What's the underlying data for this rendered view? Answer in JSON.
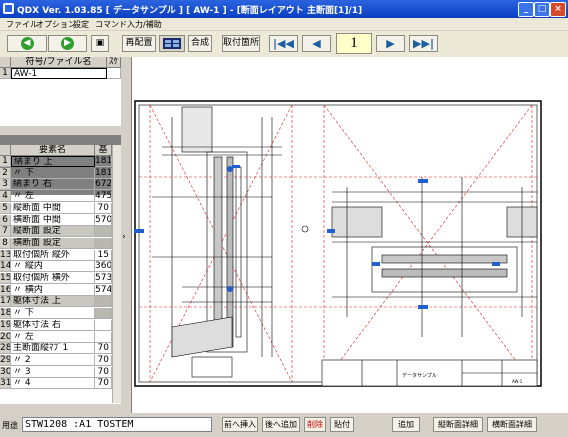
{
  "window": {
    "title": "QDX Ver. 1.03.85 [ データサンプル ] [ AW-1 ] - [断面レイアウト 主断面[1]/1]",
    "buttons": {
      "minimize": "_",
      "maximize": "□",
      "close": "×"
    }
  },
  "menu": [
    "ファイル",
    "オプション",
    "設定",
    "コマンド",
    "入力/補助"
  ],
  "toolbar": {
    "back_icon": "◀",
    "forward_icon": "▶",
    "save_icon": "▣",
    "rearrange": "再配置",
    "compose": "合成",
    "mount_point": "取付箇所",
    "first": "|◀◀",
    "prev": "◀",
    "page": "1",
    "next": "▶",
    "last": "▶▶|"
  },
  "file_grid": {
    "headers": [
      "符号/ファイル名",
      "ｽｹ"
    ],
    "rows": [
      {
        "num": "1",
        "name": "AW-1"
      }
    ]
  },
  "element_grid": {
    "headers": [
      "要素名",
      "基"
    ],
    "rows": [
      {
        "num": "1",
        "name": "納まり 上",
        "val": "181"
      },
      {
        "num": "2",
        "name": "〃 下",
        "val": "181"
      },
      {
        "num": "3",
        "name": "納まり 右",
        "val": "672"
      },
      {
        "num": "4",
        "name": "〃 左",
        "val": "475"
      },
      {
        "num": "5",
        "name": "縦断面 中間",
        "val": "70"
      },
      {
        "num": "6",
        "name": "横断面 中間",
        "val": "570"
      },
      {
        "num": "7",
        "name": "縦断面 設定",
        "val": ""
      },
      {
        "num": "8",
        "name": "横断面 設定",
        "val": ""
      },
      {
        "num": "13",
        "name": "取付個所 縦外",
        "val": "15"
      },
      {
        "num": "14",
        "name": "〃 縦内",
        "val": "360"
      },
      {
        "num": "15",
        "name": "取付個所 横外",
        "val": "573"
      },
      {
        "num": "16",
        "name": "〃 横内",
        "val": "574"
      },
      {
        "num": "17",
        "name": "躯体寸法 上",
        "val": ""
      },
      {
        "num": "18",
        "name": "〃 下",
        "val": ""
      },
      {
        "num": "19",
        "name": "躯体寸法 右",
        "val": ""
      },
      {
        "num": "20",
        "name": "〃 左",
        "val": ""
      },
      {
        "num": "28",
        "name": "主断面縦ﾏﾌﾞ1",
        "val": "70"
      },
      {
        "num": "29",
        "name": "〃 2",
        "val": "70"
      },
      {
        "num": "30",
        "name": "〃 3",
        "val": "70"
      },
      {
        "num": "31",
        "name": "〃 4",
        "val": "70"
      }
    ]
  },
  "divider_arrow": "›",
  "drawing": {
    "titleblock_text": "データサンプル",
    "titleblock_code": "AW-1"
  },
  "status": {
    "label": "用途",
    "value": "STW1208 :A1 TOSTEM",
    "buttons": [
      "前へ挿入",
      "後へ追加",
      "削除",
      "貼付",
      "追加",
      "縦断面詳細",
      "横断面詳細"
    ]
  }
}
